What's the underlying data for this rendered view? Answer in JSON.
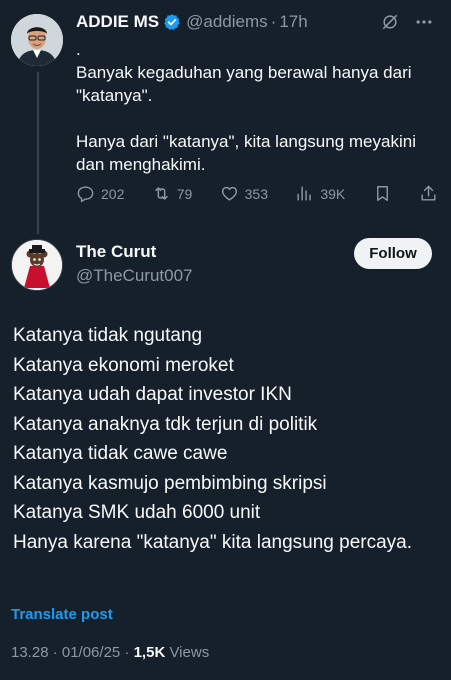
{
  "post1": {
    "author_name": "ADDIE MS",
    "handle": "@addiems",
    "separator": "·",
    "time": "17h",
    "text": ".\nBanyak kegaduhan yang berawal hanya dari \"katanya\".\n\nHanya dari \"katanya\", kita langsung meyakini dan menghakimi.",
    "stats": {
      "replies": "202",
      "reposts": "79",
      "likes": "353",
      "views": "39K"
    },
    "icons": [
      "verified-badge-icon",
      "grok-icon",
      "more-icon",
      "reply-icon",
      "repost-icon",
      "like-icon",
      "views-icon",
      "bookmark-icon",
      "share-icon"
    ]
  },
  "post2": {
    "author_name": "The Curut",
    "handle": "@TheCurut007",
    "follow_label": "Follow",
    "text": "Katanya tidak ngutang\nKatanya ekonomi meroket\nKatanya udah dapat investor IKN\nKatanya anaknya tdk terjun di politik\nKatanya tidak cawe cawe\nKatanya kasmujo pembimbing skripsi\nKatanya SMK udah 6000 unit\nHanya karena \"katanya\" kita langsung percaya.",
    "translate_label": "Translate post",
    "timestamp": "13.28 · 01/06/25 ·",
    "views_count": "1,5K",
    "views_label": "Views"
  },
  "colors": {
    "background": "#15202b",
    "text": "#f7f9f9",
    "muted": "#8b98a5",
    "accent": "#1d9bf0",
    "verified": "#1d9bf0"
  }
}
